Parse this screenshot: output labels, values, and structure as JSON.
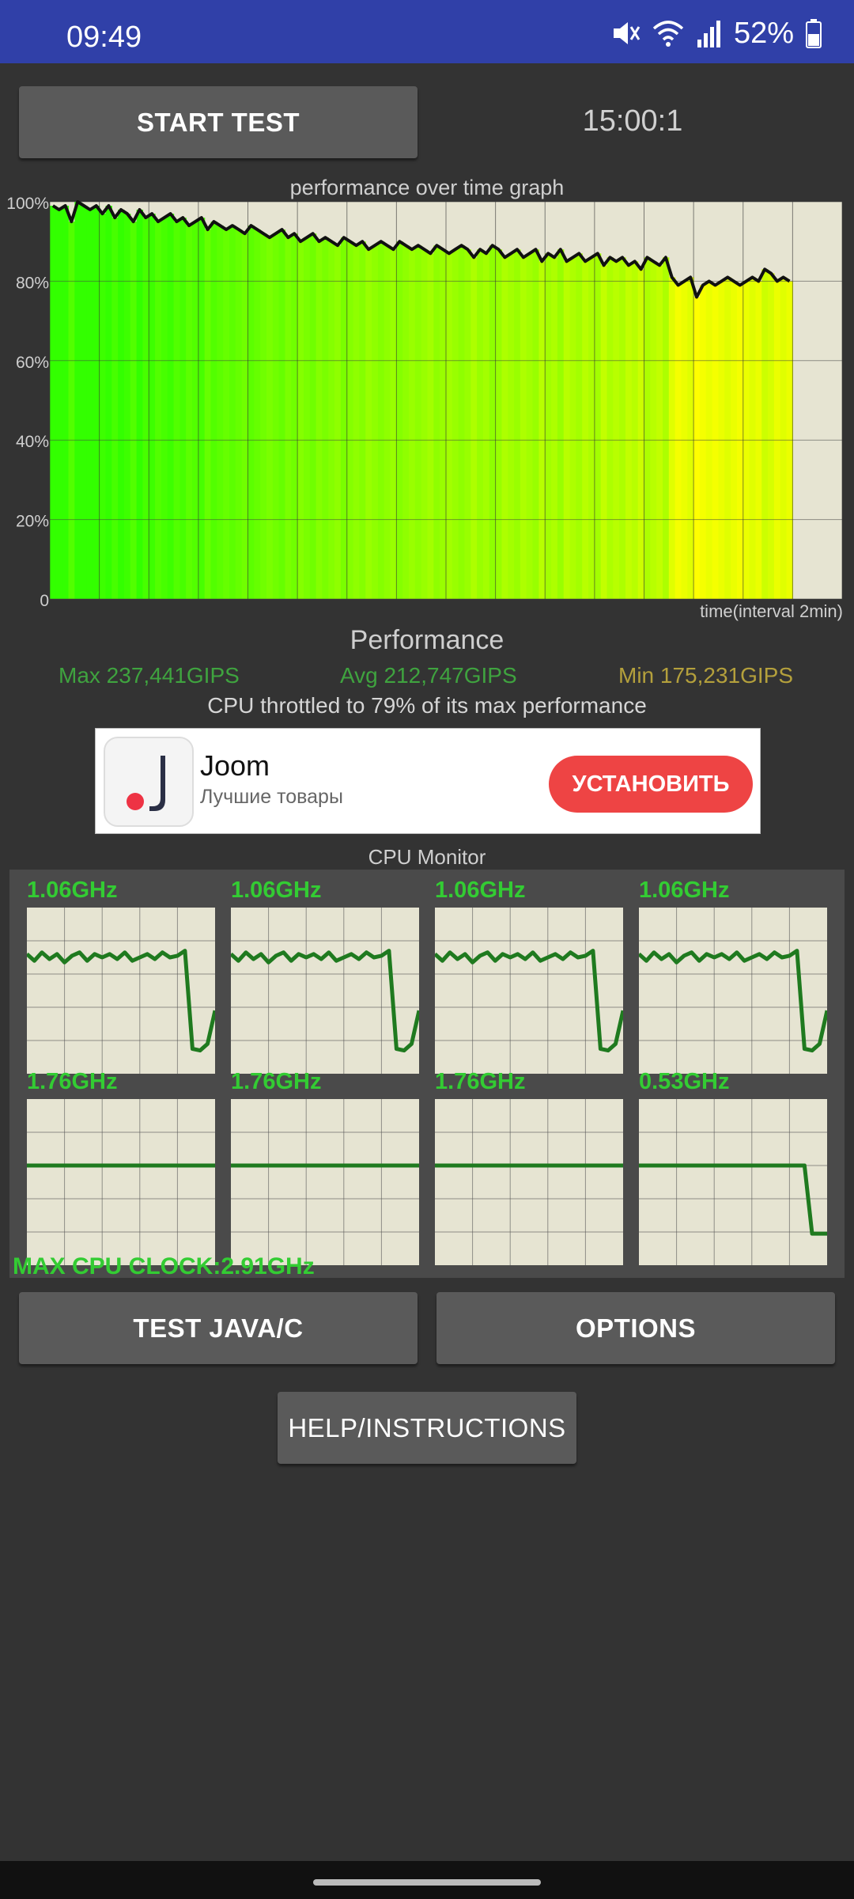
{
  "status_bar": {
    "time": "09:49",
    "battery": "52%",
    "icons": [
      "mute-icon",
      "wifi-icon",
      "signal-icon",
      "battery-icon"
    ]
  },
  "controls": {
    "start_label": "START TEST",
    "timer": "15:00:1"
  },
  "graph": {
    "title": "performance over time graph",
    "time_label": "time(interval 2min)"
  },
  "chart_data": {
    "type": "area",
    "title": "performance over time graph",
    "xlabel": "time(interval 2min)",
    "ylabel": "",
    "y_ticks": [
      "100%",
      "80%",
      "60%",
      "40%",
      "20%",
      "0"
    ],
    "ylim": [
      0,
      100
    ],
    "xlim": [
      0,
      16
    ],
    "x_grid_interval_min": 2,
    "grid": true,
    "series": [
      {
        "values": [
          99,
          98,
          99,
          95,
          100,
          99,
          98,
          99,
          97,
          99,
          96,
          98,
          97,
          95,
          98,
          96,
          97,
          95,
          96,
          97,
          95,
          96,
          94,
          95,
          96,
          93,
          95,
          94,
          93,
          94,
          93,
          92,
          94,
          93,
          92,
          91,
          92,
          93,
          91,
          92,
          90,
          91,
          92,
          90,
          91,
          90,
          89,
          91,
          90,
          89,
          90,
          88,
          89,
          90,
          89,
          88,
          90,
          89,
          88,
          89,
          88,
          87,
          89,
          88,
          87,
          88,
          89,
          88,
          86,
          88,
          87,
          89,
          88,
          86,
          87,
          88,
          86,
          87,
          88,
          85,
          87,
          86,
          88,
          85,
          86,
          87,
          85,
          86,
          87,
          84,
          86,
          85,
          86,
          84,
          85,
          83,
          86,
          85,
          84,
          86,
          81,
          79,
          80,
          81,
          76,
          79,
          80,
          79,
          80,
          81,
          80,
          79,
          80,
          81,
          80,
          83,
          82,
          80,
          81,
          80
        ],
        "range": [
          0,
          15
        ]
      }
    ]
  },
  "performance": {
    "title": "Performance",
    "max": "Max 237,441GIPS",
    "avg": "Avg 212,747GIPS",
    "min": "Min 175,231GIPS",
    "throttle": "CPU throttled to 79% of its max performance"
  },
  "ad": {
    "title": "Joom",
    "subtitle": "Лучшие товары",
    "install_label": "УСТАНОВИТЬ"
  },
  "cpu_monitor": {
    "title": "CPU Monitor",
    "cores": [
      {
        "freq": "1.06GHz",
        "values": [
          0.72,
          0.68,
          0.73,
          0.69,
          0.72,
          0.67,
          0.71,
          0.73,
          0.68,
          0.72,
          0.7,
          0.72,
          0.69,
          0.73,
          0.68,
          0.7,
          0.72,
          0.69,
          0.73,
          0.7,
          0.71,
          0.74,
          0.15,
          0.14,
          0.18,
          0.38
        ]
      },
      {
        "freq": "1.06GHz",
        "values": [
          0.72,
          0.68,
          0.73,
          0.69,
          0.72,
          0.67,
          0.71,
          0.73,
          0.68,
          0.72,
          0.7,
          0.72,
          0.69,
          0.73,
          0.68,
          0.7,
          0.72,
          0.69,
          0.73,
          0.7,
          0.71,
          0.74,
          0.15,
          0.14,
          0.18,
          0.38
        ]
      },
      {
        "freq": "1.06GHz",
        "values": [
          0.72,
          0.68,
          0.73,
          0.69,
          0.72,
          0.67,
          0.71,
          0.73,
          0.68,
          0.72,
          0.7,
          0.72,
          0.69,
          0.73,
          0.68,
          0.7,
          0.72,
          0.69,
          0.73,
          0.7,
          0.71,
          0.74,
          0.15,
          0.14,
          0.18,
          0.38
        ]
      },
      {
        "freq": "1.06GHz",
        "values": [
          0.72,
          0.68,
          0.73,
          0.69,
          0.72,
          0.67,
          0.71,
          0.73,
          0.68,
          0.72,
          0.7,
          0.72,
          0.69,
          0.73,
          0.68,
          0.7,
          0.72,
          0.69,
          0.73,
          0.7,
          0.71,
          0.74,
          0.15,
          0.14,
          0.18,
          0.38
        ]
      },
      {
        "freq": "1.76GHz",
        "values": [
          0.6,
          0.6,
          0.6,
          0.6,
          0.6,
          0.6,
          0.6,
          0.6,
          0.6,
          0.6,
          0.6,
          0.6,
          0.6,
          0.6,
          0.6,
          0.6,
          0.6,
          0.6,
          0.6,
          0.6,
          0.6,
          0.6,
          0.6,
          0.6,
          0.6,
          0.6
        ]
      },
      {
        "freq": "1.76GHz",
        "values": [
          0.6,
          0.6,
          0.6,
          0.6,
          0.6,
          0.6,
          0.6,
          0.6,
          0.6,
          0.6,
          0.6,
          0.6,
          0.6,
          0.6,
          0.6,
          0.6,
          0.6,
          0.6,
          0.6,
          0.6,
          0.6,
          0.6,
          0.6,
          0.6,
          0.6,
          0.6
        ]
      },
      {
        "freq": "1.76GHz",
        "values": [
          0.6,
          0.6,
          0.6,
          0.6,
          0.6,
          0.6,
          0.6,
          0.6,
          0.6,
          0.6,
          0.6,
          0.6,
          0.6,
          0.6,
          0.6,
          0.6,
          0.6,
          0.6,
          0.6,
          0.6,
          0.6,
          0.6,
          0.6,
          0.6,
          0.6,
          0.6
        ]
      },
      {
        "freq": "0.53GHz",
        "values": [
          0.6,
          0.6,
          0.6,
          0.6,
          0.6,
          0.6,
          0.6,
          0.6,
          0.6,
          0.6,
          0.6,
          0.6,
          0.6,
          0.6,
          0.6,
          0.6,
          0.6,
          0.6,
          0.6,
          0.6,
          0.6,
          0.6,
          0.6,
          0.19,
          0.19,
          0.19
        ]
      }
    ],
    "max_clock": "MAX CPU CLOCK:2.91GHz"
  },
  "buttons": {
    "test_label": "TEST JAVA/C",
    "options_label": "OPTIONS",
    "help_label": "HELP/INSTRUCTIONS"
  },
  "colors": {
    "status_bar": "#3040a8",
    "background": "#333333",
    "graph_bg": "#e6e4d2",
    "good": "#33ff00",
    "throttled": "#ffff00",
    "cpu_line": "#1f7a1f",
    "ad_button": "#ee4444"
  }
}
